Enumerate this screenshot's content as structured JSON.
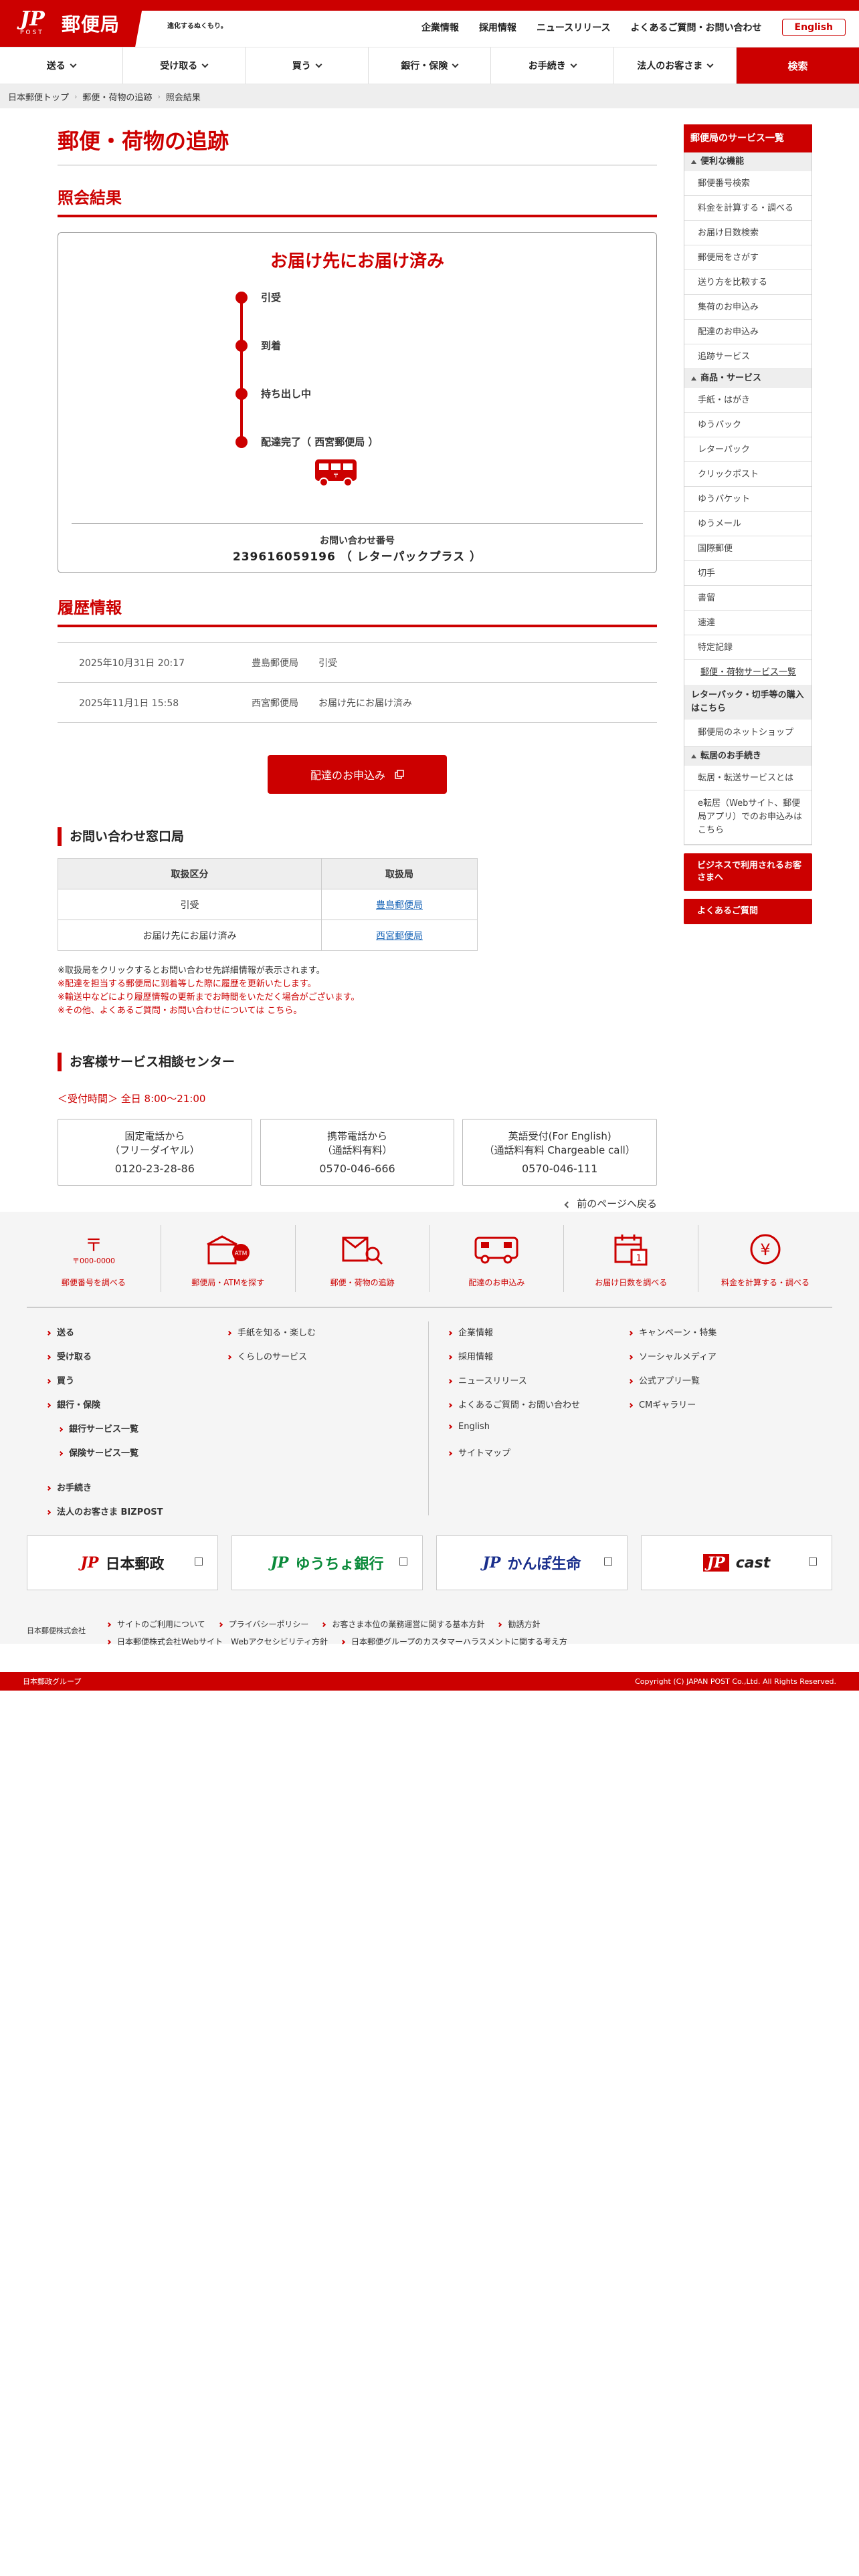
{
  "header": {
    "logo_text": "郵便局",
    "logo_mark": "JP",
    "logo_post": "POST",
    "tagline": "進化するぬくもり。",
    "top_links": [
      "企業情報",
      "採用情報",
      "ニュースリリース",
      "よくあるご質問・お問い合わせ"
    ],
    "english_button": "English"
  },
  "nav": {
    "items": [
      "送る",
      "受け取る",
      "買う",
      "銀行・保険",
      "お手続き",
      "法人のお客さま"
    ],
    "search": "検索"
  },
  "breadcrumb": [
    "日本郵便トップ",
    "郵便・荷物の追跡",
    "照会結果"
  ],
  "main": {
    "page_title": "郵便・荷物の追跡",
    "result_heading": "照会結果",
    "result": {
      "status_title": "お届け先にお届け済み",
      "steps": [
        "引受",
        "到着",
        "持ち出し中",
        "配達完了（ 西宮郵便局 ）"
      ],
      "inquiry_label": "お問い合わせ番号",
      "inquiry_number": "239616059196 （ レターパックプラス ）"
    },
    "history_heading": "履歴情報",
    "history": [
      {
        "date": "2025年10月31日 20:17",
        "office": "豊島郵便局",
        "status": "引受"
      },
      {
        "date": "2025年11月1日 15:58",
        "office": "西宮郵便局",
        "status": "お届け先にお届け済み"
      }
    ],
    "apply_button": "配達のお申込み",
    "window_heading": "お問い合わせ窓口局",
    "window_table": {
      "headers": [
        "取扱区分",
        "取扱局"
      ],
      "rows": [
        {
          "kind": "引受",
          "office": "豊島郵便局"
        },
        {
          "kind": "お届け先にお届け済み",
          "office": "西宮郵便局"
        }
      ]
    },
    "notes": [
      "※取扱局をクリックするとお問い合わせ先詳細情報が表示されます。",
      "※配達を担当する郵便局に到着等した際に履歴を更新いたします。",
      "※輸送中などにより履歴情報の更新までお時間をいただく場合がございます。",
      "※その他、よくあるご質問・お問い合わせについては こちら。"
    ],
    "center_heading": "お客様サービス相談センター",
    "hours": "＜受付時間＞ 全日 8:00〜21:00",
    "tel_cards": [
      {
        "line1": "固定電話から",
        "line2": "（フリーダイヤル）",
        "number": "0120-23-28-86"
      },
      {
        "line1": "携帯電話から",
        "line2": "（通話料有料）",
        "number": "0570-046-666"
      },
      {
        "line1": "英語受付(For English)",
        "line2": "（通話料有料 Chargeable call）",
        "number": "0570-046-111"
      }
    ],
    "back_link": "前のページへ戻る"
  },
  "sidebar": {
    "title": "郵便局のサービス一覧",
    "cat1": "便利な機能",
    "cat1_items": [
      "郵便番号検索",
      "料金を計算する・調べる",
      "お届け日数検索",
      "郵便局をさがす",
      "送り方を比較する",
      "集荷のお申込み",
      "配達のお申込み",
      "追跡サービス"
    ],
    "cat2": "商品・サービス",
    "cat2_items": [
      "手紙・はがき",
      "ゆうパック",
      "レターパック",
      "クリックポスト",
      "ゆうパケット",
      "ゆうメール",
      "国際郵便",
      "切手",
      "書留",
      "速達",
      "特定記録"
    ],
    "cat2_link": "郵便・荷物サービス一覧",
    "cat3": "レターパック・切手等の購入はこちら",
    "cat3_items": [
      "郵便局のネットショップ"
    ],
    "cat4": "転居のお手続き",
    "cat4_items": [
      "転居・転送サービスとは",
      "e転居（Webサイト、郵便局アプリ）でのお申込みはこちら"
    ],
    "biz_button": "ビジネスで利用されるお客さまへ",
    "faq_button": "よくあるご質問"
  },
  "footer": {
    "icons": [
      {
        "label": "郵便番号を調べる",
        "icon": "postcode-icon",
        "caption": "〒000-0000"
      },
      {
        "label": "郵便局・ATMを探す",
        "icon": "post-office-atm-icon",
        "caption": "ATM"
      },
      {
        "label": "郵便・荷物の追跡",
        "icon": "tracking-icon",
        "caption": ""
      },
      {
        "label": "配達のお申込み",
        "icon": "delivery-truck-icon",
        "caption": ""
      },
      {
        "label": "お届け日数を調べる",
        "icon": "calendar-icon",
        "caption": "1"
      },
      {
        "label": "料金を計算する・調べる",
        "icon": "yen-icon",
        "caption": "¥"
      }
    ],
    "col1": [
      "送る",
      "受け取る",
      "買う",
      "銀行・保険"
    ],
    "col1_sub": [
      "銀行サービス一覧",
      "保険サービス一覧"
    ],
    "col1_more": [
      "お手続き",
      "法人のお客さま BIZPOST"
    ],
    "col2": [
      "手紙を知る・楽しむ",
      "くらしのサービス"
    ],
    "col3": [
      "企業情報",
      "採用情報",
      "ニュースリリース",
      "よくあるご質問・お問い合わせ",
      "English",
      "サイトマップ"
    ],
    "col4": [
      "キャンペーン・特集",
      "ソーシャルメディア",
      "公式アプリ一覧",
      "CMギャラリー"
    ],
    "banners": [
      {
        "name": "日本郵政",
        "color": "#cc0000",
        "mark": "JP"
      },
      {
        "name": "ゆうちょ銀行",
        "color": "#0a8a3a",
        "mark": "JP"
      },
      {
        "name": "かんぽ生命",
        "color": "#1a2f8c",
        "mark": "JP"
      },
      {
        "name": "cast",
        "color": "#cc0000",
        "mark": "JP"
      }
    ],
    "corp_name": "日本郵便株式会社",
    "bottom_row1": [
      "サイトのご利用について",
      "プライバシーポリシー",
      "お客さま本位の業務運営に関する基本方針",
      "勧誘方針"
    ],
    "bottom_row2": [
      "日本郵便株式会社Webサイト　Webアクセシビリティ方針",
      "日本郵便グループのカスタマーハラスメントに関する考え方"
    ],
    "group_label": "日本郵政グループ",
    "copyright": "Copyright (C) JAPAN POST Co.,Ltd. All Rights Reserved."
  },
  "colors": {
    "brand": "#cc0000",
    "link": "#1a66b8"
  }
}
